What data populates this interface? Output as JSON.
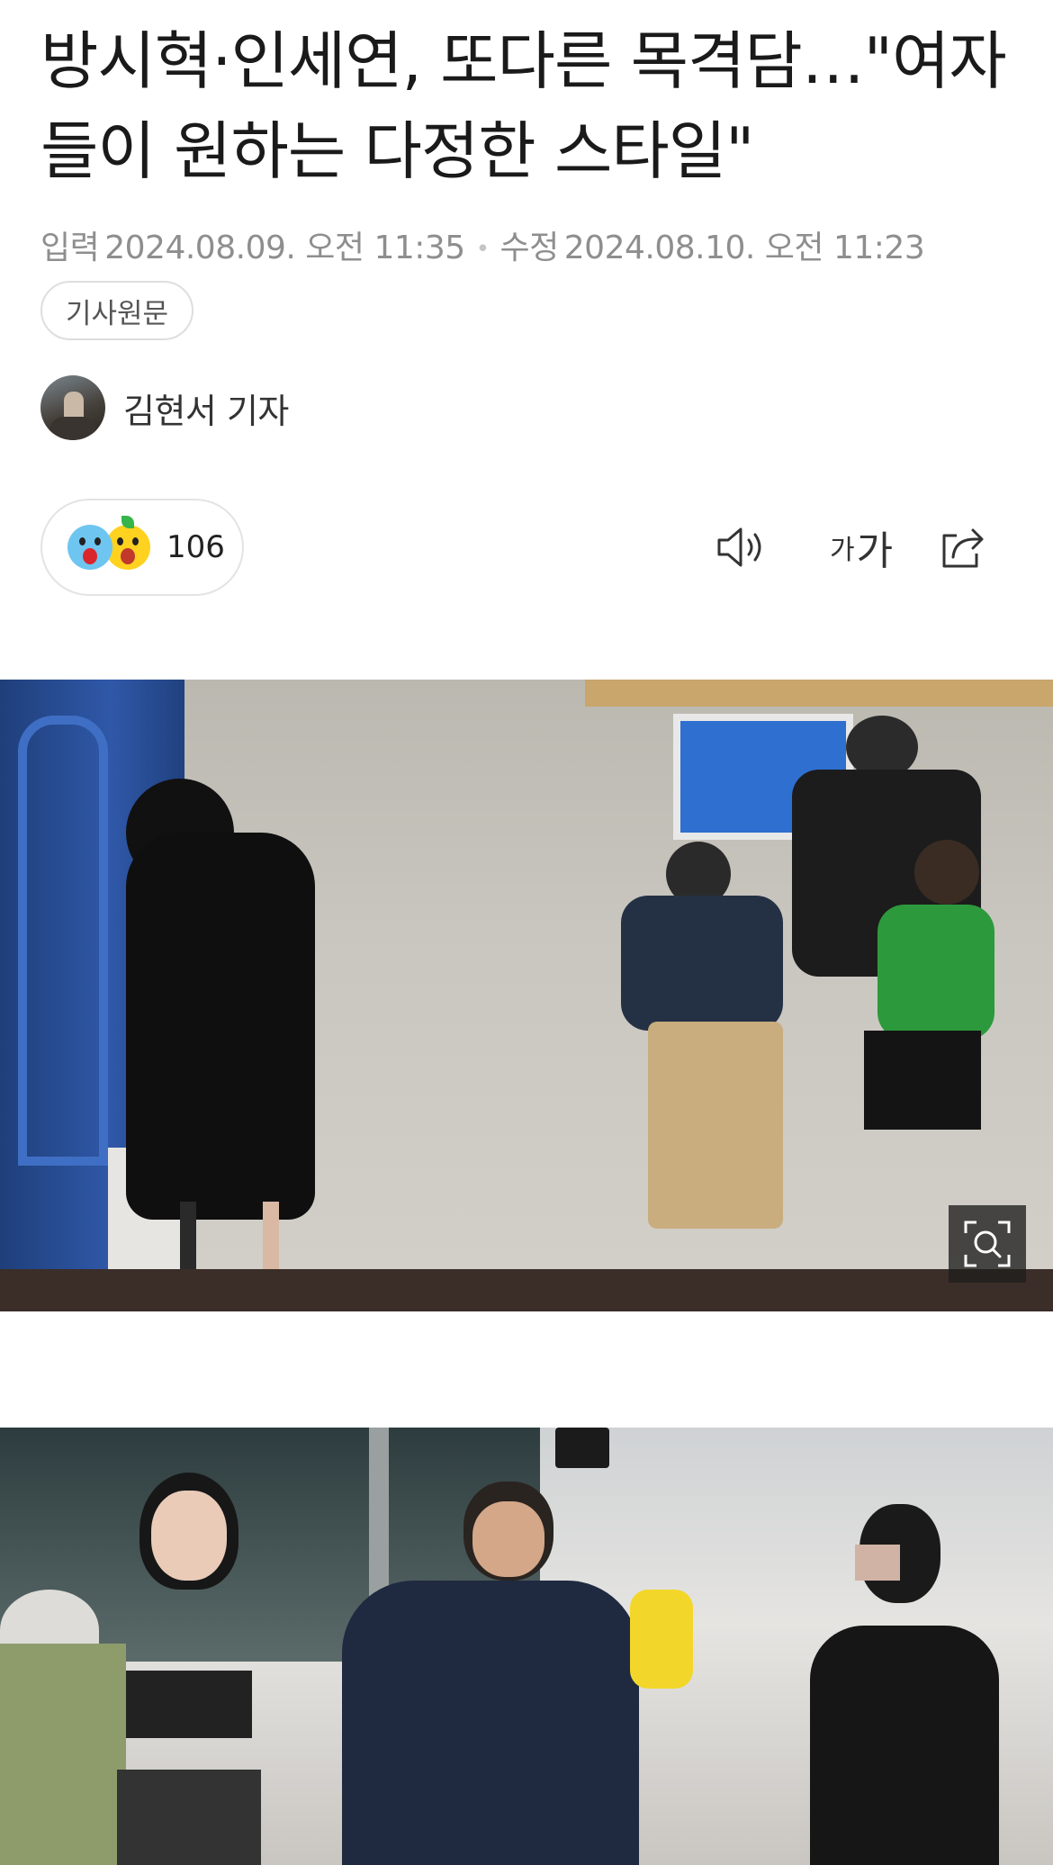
{
  "article": {
    "title": "방시혁·인세연, 또다른 목격담…\"여자들이 원하는 다정한 스타일\"",
    "input_label": "입력",
    "input_date": "2024.08.09. 오전 11:35",
    "modified_label": "수정",
    "modified_date": "2024.08.10. 오전 11:23",
    "original_article_label": "기사원문",
    "reporter": "김현서 기자"
  },
  "reactions": {
    "count": "106",
    "icons": [
      "scared-face-icon",
      "surprised-face-icon"
    ]
  },
  "toolbar": {
    "tts_icon": "speaker-icon",
    "font_small": "가",
    "font_large": "가",
    "share_icon": "share-icon"
  },
  "photos": [
    {
      "description_icon": "zoom-search-icon"
    },
    {}
  ],
  "colors": {
    "meta_text": "#8e8e8e",
    "border": "#e3e3e3",
    "headline": "#1a1a1a"
  }
}
